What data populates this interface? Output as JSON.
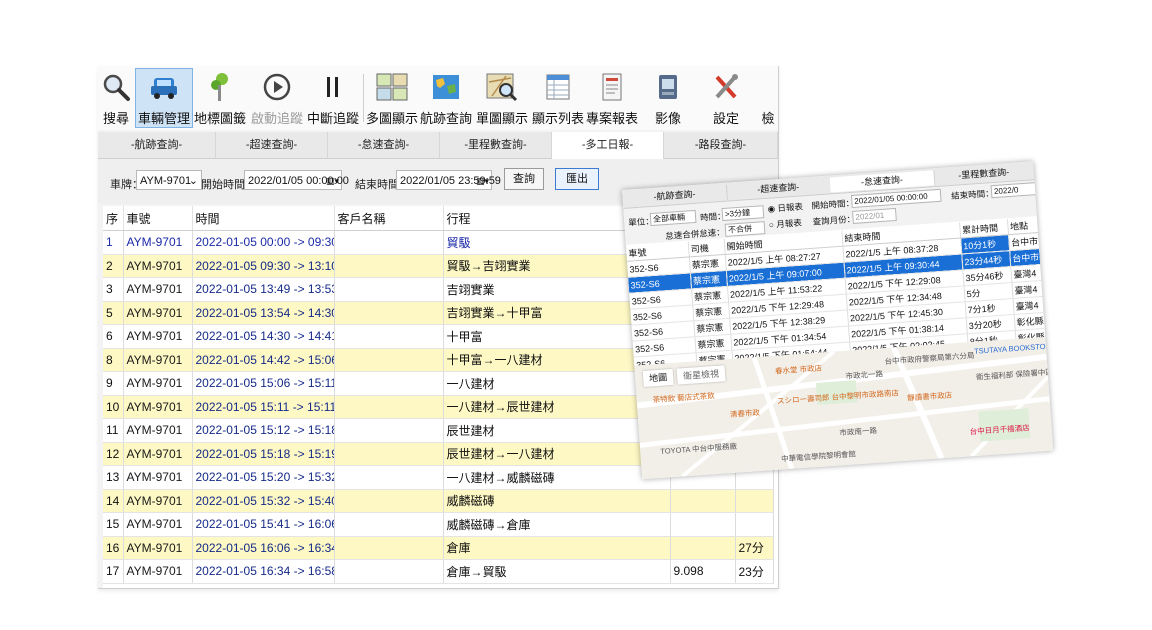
{
  "toolbar": {
    "items": [
      {
        "label": "搜尋",
        "icon": "magnifier-icon"
      },
      {
        "label": "車輛管理",
        "icon": "car-icon"
      },
      {
        "label": "地標圖籤",
        "icon": "pushpin-icon"
      },
      {
        "label": "啟動追蹤",
        "icon": "play-circle-icon"
      },
      {
        "label": "中斷追蹤",
        "icon": "pause-icon"
      },
      {
        "label": "多圖顯示",
        "icon": "multi-map-icon"
      },
      {
        "label": "航跡查詢",
        "icon": "globe-map-icon"
      },
      {
        "label": "單圖顯示",
        "icon": "map-search-icon"
      },
      {
        "label": "顯示列表",
        "icon": "table-list-icon"
      },
      {
        "label": "專案報表",
        "icon": "report-icon"
      },
      {
        "label": "影像",
        "icon": "video-icon"
      },
      {
        "label": "設定",
        "icon": "tools-icon"
      },
      {
        "label": "檢",
        "icon": "inspect-icon"
      }
    ]
  },
  "tabs": [
    "-航跡查詢-",
    "-超速查詢-",
    "-怠速查詢-",
    "-里程數查詢-",
    "-多工日報-",
    "-路段查詢-"
  ],
  "active_tab": "-多工日報-",
  "filter": {
    "plate_label": "車牌：",
    "plate_value": "AYM-9701",
    "start_label": "開始時間：",
    "start_value": "2022/01/05 00:00:00",
    "end_label": "結束時間：",
    "end_value": "2022/01/05 23:59:59",
    "query_button": "查詢",
    "export_button": "匯出"
  },
  "table": {
    "headers": [
      "序",
      "車號",
      "時間",
      "客戶名稱",
      "行程"
    ],
    "rows": [
      {
        "seq": "1",
        "car": "AYM-9701",
        "time": "2022-01-05 00:00 -> 09:30",
        "customer": "",
        "trip": "貿馺",
        "km": "",
        "dur": ""
      },
      {
        "seq": "2",
        "car": "AYM-9701",
        "time": "2022-01-05 09:30 -> 13:10",
        "customer": "",
        "trip": "貿馺→吉翊實業",
        "km": "",
        "dur": ""
      },
      {
        "seq": "3",
        "car": "AYM-9701",
        "time": "2022-01-05 13:49 -> 13:53",
        "customer": "",
        "trip": "吉翊實業",
        "km": "",
        "dur": ""
      },
      {
        "seq": "5",
        "car": "AYM-9701",
        "time": "2022-01-05 13:54 -> 14:30",
        "customer": "",
        "trip": "吉翊實業→十甲富",
        "km": "",
        "dur": ""
      },
      {
        "seq": "6",
        "car": "AYM-9701",
        "time": "2022-01-05 14:30 -> 14:41",
        "customer": "",
        "trip": "十甲富",
        "km": "",
        "dur": ""
      },
      {
        "seq": "8",
        "car": "AYM-9701",
        "time": "2022-01-05 14:42 -> 15:06",
        "customer": "",
        "trip": "十甲富→一八建材",
        "km": "",
        "dur": ""
      },
      {
        "seq": "9",
        "car": "AYM-9701",
        "time": "2022-01-05 15:06 -> 15:11",
        "customer": "",
        "trip": "一八建材",
        "km": "",
        "dur": ""
      },
      {
        "seq": "10",
        "car": "AYM-9701",
        "time": "2022-01-05 15:11 -> 15:11",
        "customer": "",
        "trip": "一八建材→辰世建材",
        "km": "",
        "dur": ""
      },
      {
        "seq": "11",
        "car": "AYM-9701",
        "time": "2022-01-05 15:12 -> 15:18",
        "customer": "",
        "trip": "辰世建材",
        "km": "",
        "dur": ""
      },
      {
        "seq": "12",
        "car": "AYM-9701",
        "time": "2022-01-05 15:18 -> 15:19",
        "customer": "",
        "trip": "辰世建材→一八建材",
        "km": "",
        "dur": ""
      },
      {
        "seq": "13",
        "car": "AYM-9701",
        "time": "2022-01-05 15:20 -> 15:32",
        "customer": "",
        "trip": "一八建材→威麟磁磚",
        "km": "",
        "dur": ""
      },
      {
        "seq": "14",
        "car": "AYM-9701",
        "time": "2022-01-05 15:32 -> 15:40",
        "customer": "",
        "trip": "威麟磁磚",
        "km": "",
        "dur": ""
      },
      {
        "seq": "15",
        "car": "AYM-9701",
        "time": "2022-01-05 15:41 -> 16:06",
        "customer": "",
        "trip": "威麟磁磚→倉庫",
        "km": "",
        "dur": ""
      },
      {
        "seq": "16",
        "car": "AYM-9701",
        "time": "2022-01-05 16:06 -> 16:34",
        "customer": "",
        "trip": "倉庫",
        "km": "",
        "dur": "27分"
      },
      {
        "seq": "17",
        "car": "AYM-9701",
        "time": "2022-01-05 16:34 -> 16:58",
        "customer": "",
        "trip": "倉庫→貿馺",
        "km": "9.098",
        "dur": "23分"
      }
    ]
  },
  "overlay": {
    "tabs": [
      "-航跡查詢-",
      "-超速查詢-",
      "-怠速查詢-",
      "-里程數查詢-"
    ],
    "filter": {
      "dept_label": "單位：",
      "dept_value": "全部車輛",
      "time_label": "時間：",
      "time_value": ">3分鐘",
      "radio_daily": "日報表",
      "radio_monthly": "月報表",
      "start_label": "開始時間：",
      "start_value": "2022/01/05 00:00:00",
      "month_label": "查詢月份：",
      "month_value": "2022/01",
      "end_label": "結束時間：",
      "end_value": "2022/0",
      "speed_label": "怠速合併怠速：",
      "speed_value": "不合併"
    },
    "headers": [
      "車號",
      "司機",
      "開始時間",
      "結束時間",
      "累計時間",
      "地點"
    ],
    "rows": [
      [
        "352-S6",
        "蔡宗憲",
        "2022/1/5 上午 08:27:27",
        "2022/1/5 上午 08:37:28",
        "10分1秒",
        "台中市"
      ],
      [
        "352-S6",
        "蔡宗憲",
        "2022/1/5 上午 09:07:00",
        "2022/1/5 上午 09:30:44",
        "23分44秒",
        "台中市"
      ],
      [
        "352-S6",
        "蔡宗憲",
        "2022/1/5 上午 11:53:22",
        "2022/1/5 下午 12:29:08",
        "35分46秒",
        "臺灣4"
      ],
      [
        "352-S6",
        "蔡宗憲",
        "2022/1/5 下午 12:29:48",
        "2022/1/5 下午 12:34:48",
        "5分",
        "臺灣4"
      ],
      [
        "352-S6",
        "蔡宗憲",
        "2022/1/5 下午 12:38:29",
        "2022/1/5 下午 12:45:30",
        "7分1秒",
        "臺灣4"
      ],
      [
        "352-S6",
        "蔡宗憲",
        "2022/1/5 下午 01:34:54",
        "2022/1/5 下午 01:38:14",
        "3分20秒",
        "彰化縣"
      ],
      [
        "352-S6",
        "蔡宗憲",
        "2022/1/5 下午 01:54:44",
        "2022/1/5 下午 02:02:45",
        "8分1秒",
        "彰化縣"
      ],
      [
        "352-S6",
        "蔡宗憲",
        "2022/1/5 下午 02:48:03",
        "2022/1/5 下午 02:52:44",
        "4分41秒",
        "彰化縣"
      ],
      [
        "352-S6",
        "蔡宗憲",
        "",
        "",
        "",
        ""
      ]
    ],
    "map": {
      "type_map": "地圖",
      "type_satellite": "衛星檢視",
      "labels": [
        "台中市政府警察局第六分局",
        "春水堂 市政店",
        "茶特飲 藝店式茶飲",
        "スシロー壽司郎 台中黎明市政路南店",
        "清春市政",
        "靜讀書市政店",
        "TOYOTA 中台中服務廠",
        "中華電信學院黎明會館",
        "台中日月千禧酒店",
        "衛生福利部 保險署中區",
        "TSUTAYA BOOKSTORE 惠宇",
        "市政南一路",
        "市政北一路"
      ]
    }
  },
  "colors": {
    "row_highlight": "#fdf8c4",
    "selection": "#1a6fd6",
    "active_toolbar": "#cfe3f7"
  }
}
